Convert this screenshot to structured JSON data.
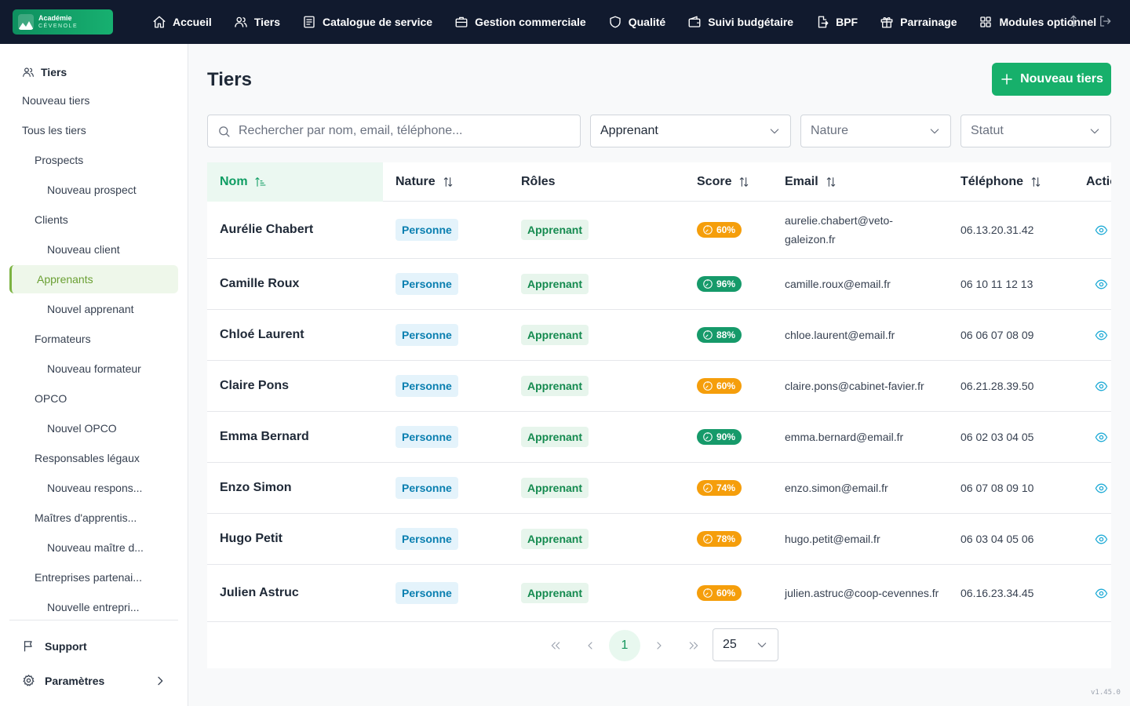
{
  "brand": {
    "line1": "Académie",
    "line2": "CÉVENOLE"
  },
  "nav": {
    "items": [
      {
        "label": "Accueil",
        "icon": "home-icon"
      },
      {
        "label": "Tiers",
        "icon": "users-icon"
      },
      {
        "label": "Catalogue de service",
        "icon": "catalog-icon"
      },
      {
        "label": "Gestion commerciale",
        "icon": "briefcase-icon"
      },
      {
        "label": "Qualité",
        "icon": "shield-icon"
      },
      {
        "label": "Suivi budgétaire",
        "icon": "wallet-icon"
      },
      {
        "label": "BPF",
        "icon": "file-export-icon"
      },
      {
        "label": "Parrainage",
        "icon": "gift-icon"
      },
      {
        "label": "Modules optionnel",
        "icon": "grid-icon"
      }
    ]
  },
  "sidebar": {
    "header": "Tiers",
    "items": [
      {
        "label": "Nouveau tiers"
      },
      {
        "label": "Tous les tiers"
      },
      {
        "label": "Prospects"
      },
      {
        "label": "Nouveau prospect"
      },
      {
        "label": "Clients"
      },
      {
        "label": "Nouveau client"
      },
      {
        "label": "Apprenants"
      },
      {
        "label": "Nouvel apprenant"
      },
      {
        "label": "Formateurs"
      },
      {
        "label": "Nouveau formateur"
      },
      {
        "label": "OPCO"
      },
      {
        "label": "Nouvel OPCO"
      },
      {
        "label": "Responsables légaux"
      },
      {
        "label": "Nouveau respons..."
      },
      {
        "label": "Maîtres d'apprentis..."
      },
      {
        "label": "Nouveau maître d..."
      },
      {
        "label": "Entreprises partenai..."
      },
      {
        "label": "Nouvelle entrepri..."
      }
    ],
    "active": "Apprenants",
    "support": "Support",
    "settings": "Paramètres"
  },
  "page": {
    "title": "Tiers",
    "new_button": "Nouveau tiers"
  },
  "filters": {
    "search_placeholder": "Rechercher par nom, email, téléphone...",
    "role_value": "Apprenant",
    "nature_placeholder": "Nature",
    "status_placeholder": "Statut"
  },
  "table": {
    "columns": {
      "nom": "Nom",
      "nature": "Nature",
      "roles": "Rôles",
      "score": "Score",
      "email": "Email",
      "telephone": "Téléphone",
      "actions": "Actions"
    },
    "rows": [
      {
        "nom": "Aurélie Chabert",
        "nature": "Personne",
        "role": "Apprenant",
        "score": "60%",
        "score_level": "warn",
        "email": "aurelie.chabert@veto-galeizon.fr",
        "telephone": "06.13.20.31.42"
      },
      {
        "nom": "Camille Roux",
        "nature": "Personne",
        "role": "Apprenant",
        "score": "96%",
        "score_level": "good",
        "email": "camille.roux@email.fr",
        "telephone": "06 10 11 12 13"
      },
      {
        "nom": "Chloé Laurent",
        "nature": "Personne",
        "role": "Apprenant",
        "score": "88%",
        "score_level": "good",
        "email": "chloe.laurent@email.fr",
        "telephone": "06 06 07 08 09"
      },
      {
        "nom": "Claire Pons",
        "nature": "Personne",
        "role": "Apprenant",
        "score": "60%",
        "score_level": "warn",
        "email": "claire.pons@cabinet-favier.fr",
        "telephone": "06.21.28.39.50"
      },
      {
        "nom": "Emma Bernard",
        "nature": "Personne",
        "role": "Apprenant",
        "score": "90%",
        "score_level": "good",
        "email": "emma.bernard@email.fr",
        "telephone": "06 02 03 04 05"
      },
      {
        "nom": "Enzo Simon",
        "nature": "Personne",
        "role": "Apprenant",
        "score": "74%",
        "score_level": "warn",
        "email": "enzo.simon@email.fr",
        "telephone": "06 07 08 09 10"
      },
      {
        "nom": "Hugo Petit",
        "nature": "Personne",
        "role": "Apprenant",
        "score": "78%",
        "score_level": "warn",
        "email": "hugo.petit@email.fr",
        "telephone": "06 03 04 05 06"
      },
      {
        "nom": "Julien Astruc",
        "nature": "Personne",
        "role": "Apprenant",
        "score": "60%",
        "score_level": "warn",
        "email": "julien.astruc@coop-cevennes.fr",
        "telephone": "06.16.23.34.45"
      }
    ]
  },
  "pagination": {
    "current_page": "1",
    "page_size": "25"
  },
  "colors": {
    "good": "#169a6a",
    "warn": "#f59e0b",
    "accent": "#17b06b"
  },
  "version": "v1.45.0"
}
